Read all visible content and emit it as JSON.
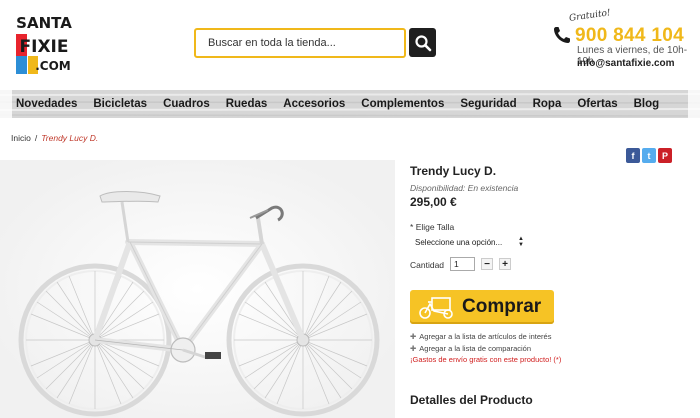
{
  "header": {
    "logo_lines": [
      "SANTA",
      "FIXIE",
      ".COM"
    ],
    "search_placeholder": "Buscar en toda la tienda...",
    "contact": {
      "badge": "Gratuito!",
      "phone": "900 844 104",
      "hours": "Lunes a viernes, de 10h-19h",
      "email": "info@santafixie.com"
    }
  },
  "nav": {
    "items": [
      "Novedades",
      "Bicicletas",
      "Cuadros",
      "Ruedas",
      "Accesorios",
      "Complementos",
      "Seguridad",
      "Ropa",
      "Ofertas",
      "Blog"
    ]
  },
  "breadcrumb": {
    "home": "Inicio",
    "separator": "/",
    "current": "Trendy Lucy D."
  },
  "social": [
    {
      "icon": "facebook-icon",
      "glyph": "f",
      "color": "#3b5998"
    },
    {
      "icon": "twitter-icon",
      "glyph": "t",
      "color": "#55acee"
    },
    {
      "icon": "pinterest-icon",
      "glyph": "P",
      "color": "#cb2027"
    }
  ],
  "product": {
    "title": "Trendy Lucy D.",
    "availability": "Disponibilidad: En existencia",
    "price": "295,00 €",
    "size_required": "*",
    "size_label": "Elige Talla",
    "size_select_value": "Seleccione una opción...",
    "qty_label": "Cantidad",
    "qty_value": "1",
    "qty_minus": "−",
    "qty_plus": "+",
    "buy_label": "Comprar",
    "wishlist_link": "Agregar a la lista de artículos de interés",
    "compare_link": "Agregar a la lista de comparación",
    "shipping_note": "¡Gastos de envío gratis con este producto! (*)",
    "details_heading": "Detalles del Producto"
  },
  "colors": {
    "accent": "#f0b81a",
    "button": "#f6c325",
    "price_red": "#c0392b"
  }
}
